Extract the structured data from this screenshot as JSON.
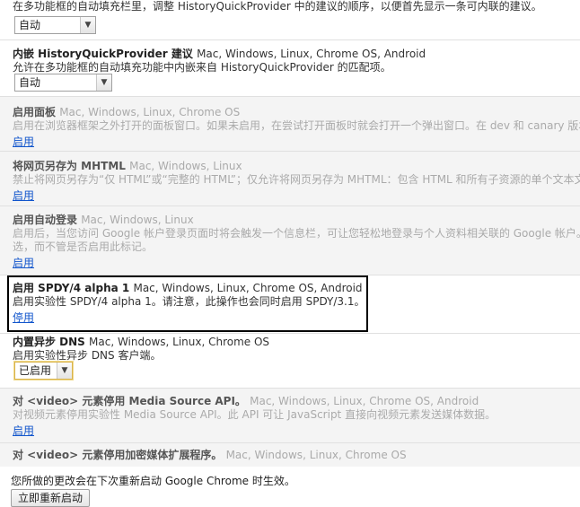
{
  "flags": [
    {
      "id": "top",
      "desc": "在多功能框的自动填充栏里，调整 HistoryQuickProvider 中的建议的顺序，以便首先显示一条可内联的建议。",
      "select": "自动"
    },
    {
      "id": "hqp_inline",
      "title": "内嵌 HistoryQuickProvider 建议",
      "platforms": "Mac, Windows, Linux, Chrome OS, Android",
      "desc": "允许在多功能框的自动填充功能中内嵌来自 HistoryQuickProvider 的匹配项。",
      "select": "自动"
    },
    {
      "id": "panels",
      "title": "启用面板",
      "platforms": "Mac, Windows, Linux, Chrome OS",
      "desc": "启用在浏览器框架之外打开的面板窗口。如果未启用，在尝试打开面板时就会打开一个弹出窗口。在 dev 和 canary 版本中",
      "link": "启用"
    },
    {
      "id": "mhtml",
      "title": "将网页另存为 MHTML",
      "platforms": "Mac, Windows, Linux",
      "desc": "禁止将网页另存为“仅 HTML”或“完整的 HTML”；仅允许将网页另存为 MHTML：包含 HTML 和所有子资源的单个文本文",
      "link": "启用"
    },
    {
      "id": "autologin",
      "title": "启用自动登录",
      "platforms": "Mac, Windows, Linux",
      "desc": "启用后，当您访问 Google 帐户登录页面时将会触发一个信息栏，可让您轻松地登录与个人资料相关联的 Google 帐户。如",
      "desc2": "选，而不管是否启用此标记。",
      "link": "启用"
    },
    {
      "id": "spdy4",
      "title": "启用 SPDY/4 alpha 1",
      "platforms": "Mac, Windows, Linux, Chrome OS, Android",
      "desc": "启用实验性 SPDY/4 alpha 1。请注意，此操作也会同时启用 SPDY/3.1。",
      "link": "停用"
    },
    {
      "id": "async_dns",
      "title": "内置异步 DNS",
      "platforms": "Mac, Windows, Linux, Chrome OS",
      "desc": "启用实验性异步 DNS 客户端。",
      "select": "已启用"
    },
    {
      "id": "mse",
      "title": "对 <video> 元素停用 Media Source API。",
      "platforms": "Mac, Windows, Linux, Chrome OS, Android",
      "desc": "对视频元素停用实验性 Media Source API。此 API 可让 JavaScript 直接向视频元素发送媒体数据。",
      "link": "启用"
    },
    {
      "id": "eme",
      "title": "对 <video> 元素停用加密媒体扩展程序。",
      "platforms": "Mac, Windows, Linux, Chrome OS"
    }
  ],
  "footer": {
    "text": "您所做的更改会在下次重新启动 Google Chrome 时生效。",
    "button": "立即重新启动"
  }
}
